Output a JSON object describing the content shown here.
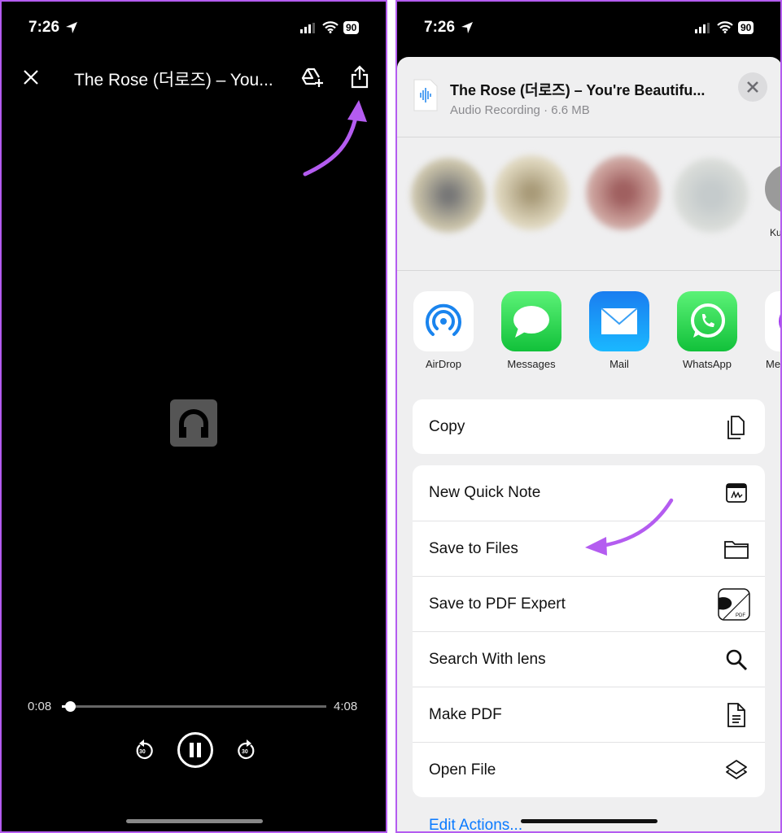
{
  "status_bar": {
    "time": "7:26",
    "battery": "90"
  },
  "player": {
    "title": "The Rose (더로즈) – You...",
    "elapsed": "0:08",
    "duration": "4:08",
    "progress_fraction": 0.033,
    "skip_back_label": "30",
    "skip_forward_label": "30"
  },
  "share_sheet": {
    "file_title": "The Rose (더로즈) – You're Beautifu...",
    "file_subtitle": "Audio Recording · 6.6 MB",
    "partial_contact": "Ku",
    "apps": [
      {
        "label": "AirDrop",
        "icon": "airdrop-icon"
      },
      {
        "label": "Messages",
        "icon": "messages-icon"
      },
      {
        "label": "Mail",
        "icon": "mail-icon"
      },
      {
        "label": "WhatsApp",
        "icon": "whatsapp-icon"
      },
      {
        "label": "Me",
        "icon": "messenger-icon"
      }
    ],
    "copy": {
      "label": "Copy",
      "icon": "copy-icon"
    },
    "actions": [
      {
        "label": "New Quick Note",
        "icon": "quick-note-icon"
      },
      {
        "label": "Save to Files",
        "icon": "folder-icon"
      },
      {
        "label": "Save to PDF Expert",
        "icon": "pdf-expert-icon"
      },
      {
        "label": "Search With lens",
        "icon": "search-icon"
      },
      {
        "label": "Make PDF",
        "icon": "document-icon"
      },
      {
        "label": "Open File",
        "icon": "layers-icon"
      }
    ],
    "edit_actions": "Edit Actions..."
  },
  "colors": {
    "annotation_arrow": "#b45cf0",
    "link": "#0a7aff"
  }
}
